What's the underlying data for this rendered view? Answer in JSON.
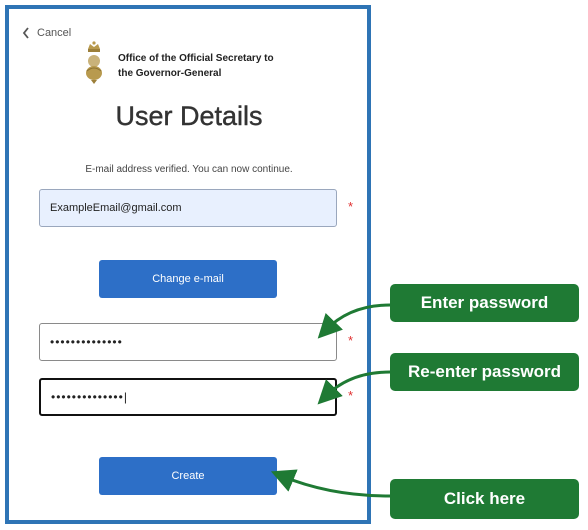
{
  "nav": {
    "cancel_label": "Cancel"
  },
  "org": {
    "name_line1": "Office of the Official Secretary to",
    "name_line2": "the Governor-General"
  },
  "page": {
    "title": "User Details",
    "status_text": "E-mail address verified. You can now continue."
  },
  "form": {
    "email_value": "ExampleEmail@gmail.com",
    "password_value": "••••••••••••••",
    "reenter_password_value": "••••••••••••••|",
    "required_marker": "*",
    "change_email_label": "Change e-mail",
    "create_label": "Create"
  },
  "annotations": {
    "enter_password": "Enter password",
    "reenter_password": "Re-enter password",
    "click_here": "Click here"
  },
  "colors": {
    "frame_border": "#2e74b5",
    "button": "#2d6fc7",
    "callout": "#1f7a34",
    "required": "#e03030"
  }
}
